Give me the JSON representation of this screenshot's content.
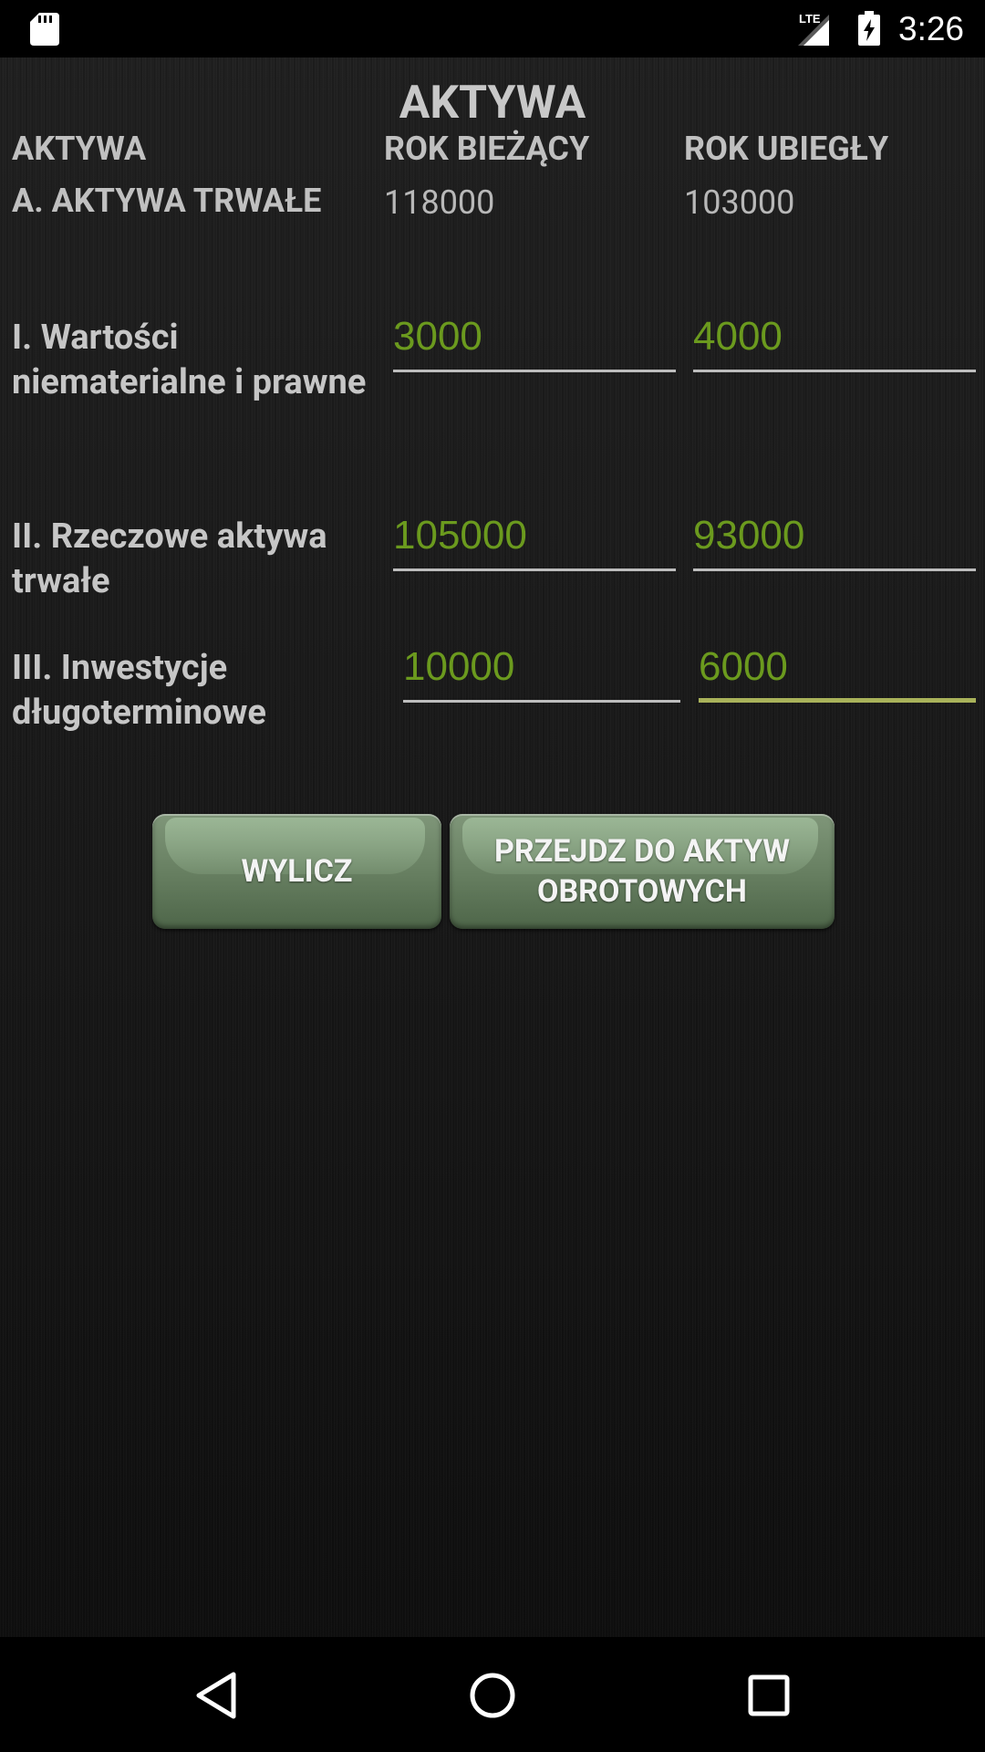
{
  "status_bar": {
    "time": "3:26",
    "network": "LTE",
    "icons": [
      "sd-card-icon",
      "signal-icon",
      "battery-charging-icon"
    ]
  },
  "page": {
    "title": "AKTYWA"
  },
  "table": {
    "headers": {
      "label": "AKTYWA",
      "current": "ROK BIEŻĄCY",
      "previous": "ROK UBIEGŁY"
    },
    "total_row": {
      "label": "A. AKTYWA TRWAŁE",
      "current": "118000",
      "previous": "103000"
    },
    "rows": [
      {
        "label": "I. Wartości niematerialne i prawne",
        "current": "3000",
        "previous": "4000"
      },
      {
        "label": "II. Rzeczowe aktywa trwałe",
        "current": "105000",
        "previous": "93000"
      },
      {
        "label": "III. Inwestycje długoterminowe",
        "current": "10000",
        "previous": "6000"
      }
    ]
  },
  "buttons": {
    "calculate": "WYLICZ",
    "next": "PRZEJDZ DO AKTYW OBROTOWYCH"
  },
  "colors": {
    "input_text": "#6b9a1e",
    "focused_underline": "#a9b25a",
    "button": "#6a8264"
  },
  "nav_bar": {
    "icons": [
      "back-icon",
      "home-icon",
      "recents-icon"
    ]
  }
}
